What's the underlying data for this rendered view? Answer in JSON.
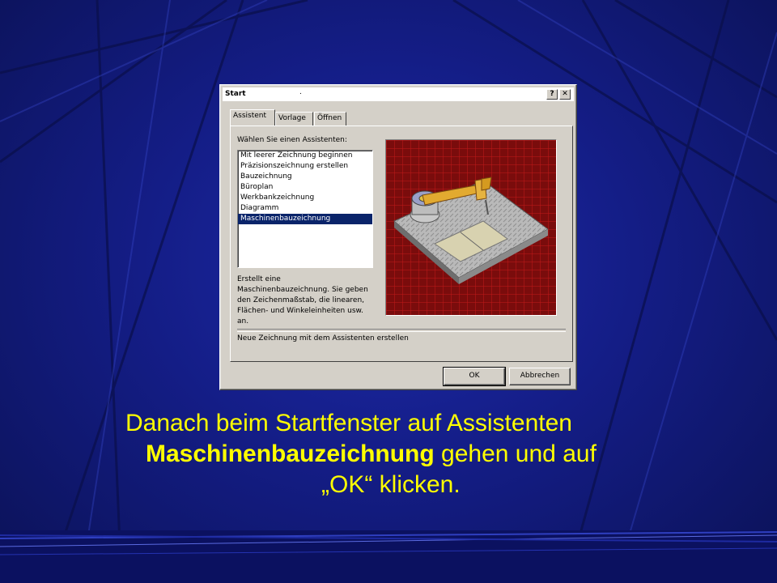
{
  "dialog": {
    "title": "Start",
    "title_dot": ".",
    "help_label": "?",
    "close_label": "✕",
    "tabs": [
      {
        "label": "Assistent",
        "active": true
      },
      {
        "label": "Vorlage",
        "active": false
      },
      {
        "label": "Öffnen",
        "active": false
      }
    ],
    "prompt": "Wählen Sie einen Assistenten:",
    "wizards": [
      {
        "label": "Mit leerer Zeichnung beginnen",
        "selected": false
      },
      {
        "label": "Präzisionszeichnung erstellen",
        "selected": false
      },
      {
        "label": "Bauzeichnung",
        "selected": false
      },
      {
        "label": "Büroplan",
        "selected": false
      },
      {
        "label": "Werkbankzeichnung",
        "selected": false
      },
      {
        "label": "Diagramm",
        "selected": false
      },
      {
        "label": "Maschinenbauzeichnung",
        "selected": true
      }
    ],
    "description": "Erstellt eine Maschinenbauzeichnung. Sie geben den Zeichenmaßstab, die linearen, Flächen- und Winkeleinheiten usw. an.",
    "status": "Neue Zeichnung mit dem Assistenten erstellen",
    "ok_label": "OK",
    "cancel_label": "Abbrechen"
  },
  "caption": {
    "line1": "Danach beim Startfenster auf Assistenten",
    "line2_bold": "Maschinenbauzeichnung",
    "line2_rest": " gehen und auf",
    "line3": "„OK“ klicken."
  },
  "colors": {
    "background": "#141d86",
    "caption_text": "#ffff00",
    "selection": "#0a246a",
    "dialog_face": "#d4d0c8"
  }
}
